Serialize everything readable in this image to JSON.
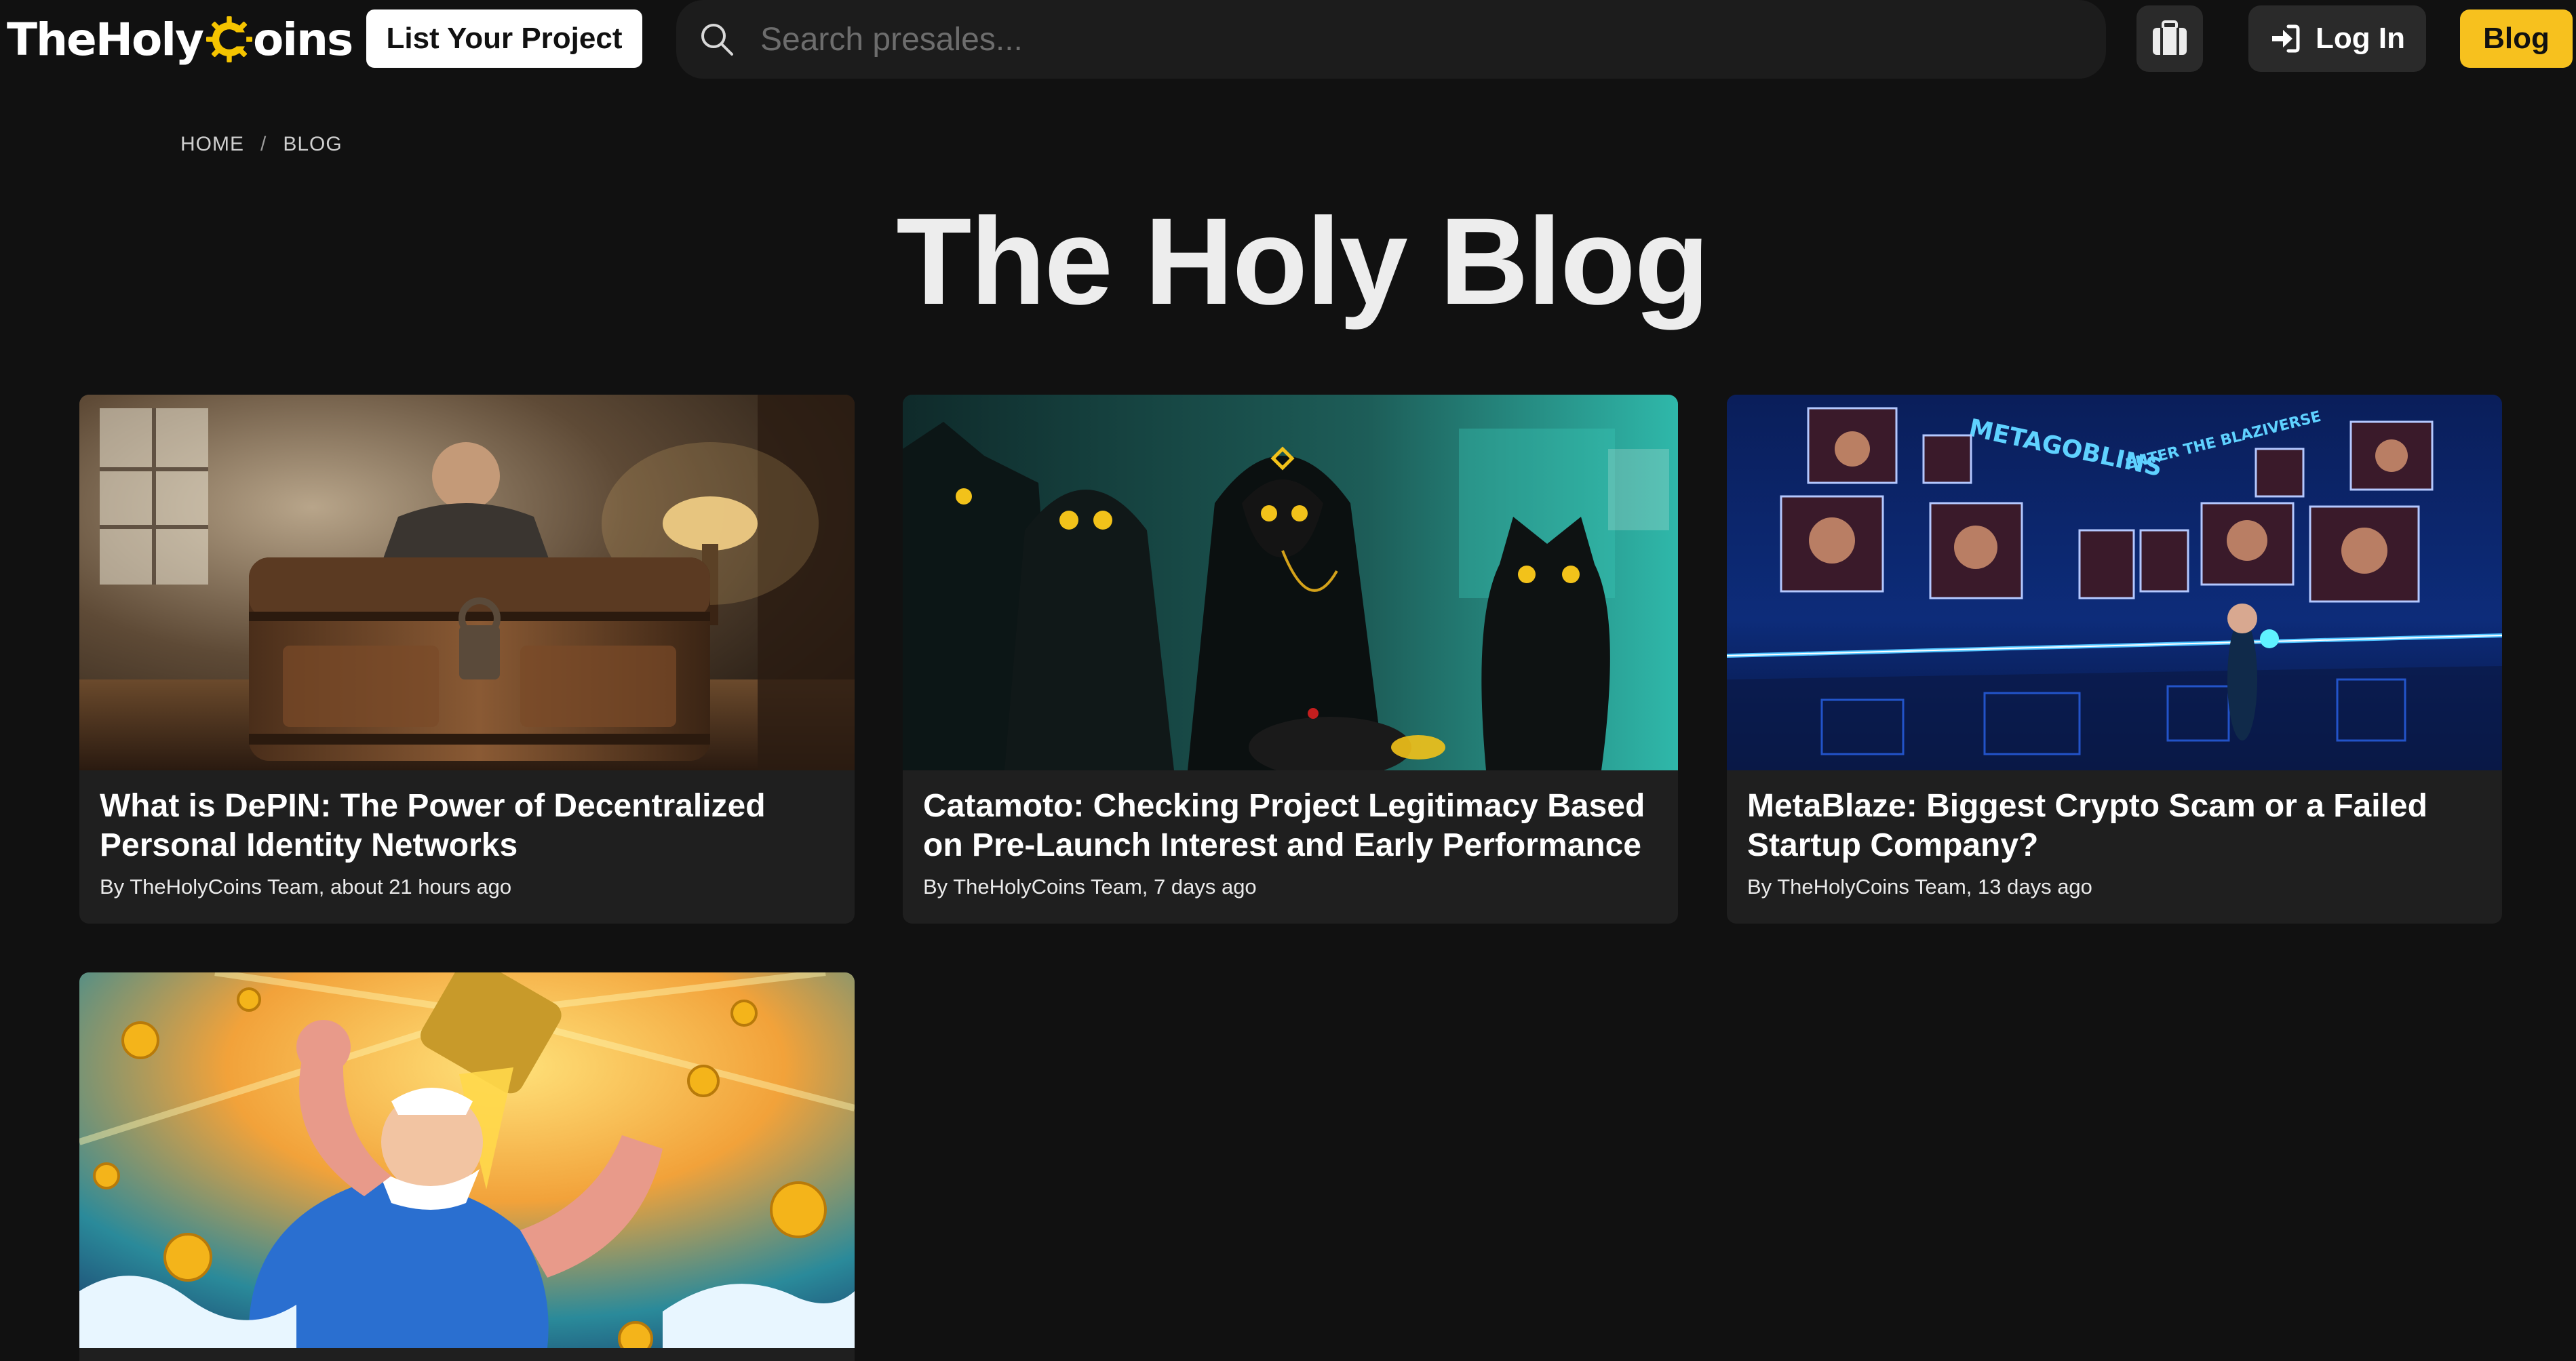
{
  "header": {
    "logo_text_before": "TheHoly",
    "logo_text_after": "oins",
    "list_project_label": "List Your Project",
    "search_placeholder": "Search presales...",
    "login_label": "Log In",
    "blog_label": "Blog",
    "accent_color": "#f7c11e"
  },
  "breadcrumb": {
    "home": "HOME",
    "separator": "/",
    "current": "BLOG"
  },
  "page": {
    "title": "The Holy Blog"
  },
  "posts": [
    {
      "title": "What is DePIN: The Power of Decentralized Personal Identity Networks",
      "meta": "By TheHolyCoins Team, about 21 hours ago",
      "image": "treasure-chest-image"
    },
    {
      "title": "Catamoto: Checking Project Legitimacy Based on Pre-Launch Interest and Early Performance",
      "meta": "By TheHolyCoins Team, 7 days ago",
      "image": "black-cats-image"
    },
    {
      "title": "MetaBlaze: Biggest Crypto Scam or a Failed Startup Company?",
      "meta": "By TheHolyCoins Team, 13 days ago",
      "image": "metagoblins-room-image",
      "image_text": [
        "METAGOBLINS",
        "ENTER THE BLAZIVERSE"
      ]
    },
    {
      "image": "sailor-coins-image"
    }
  ]
}
